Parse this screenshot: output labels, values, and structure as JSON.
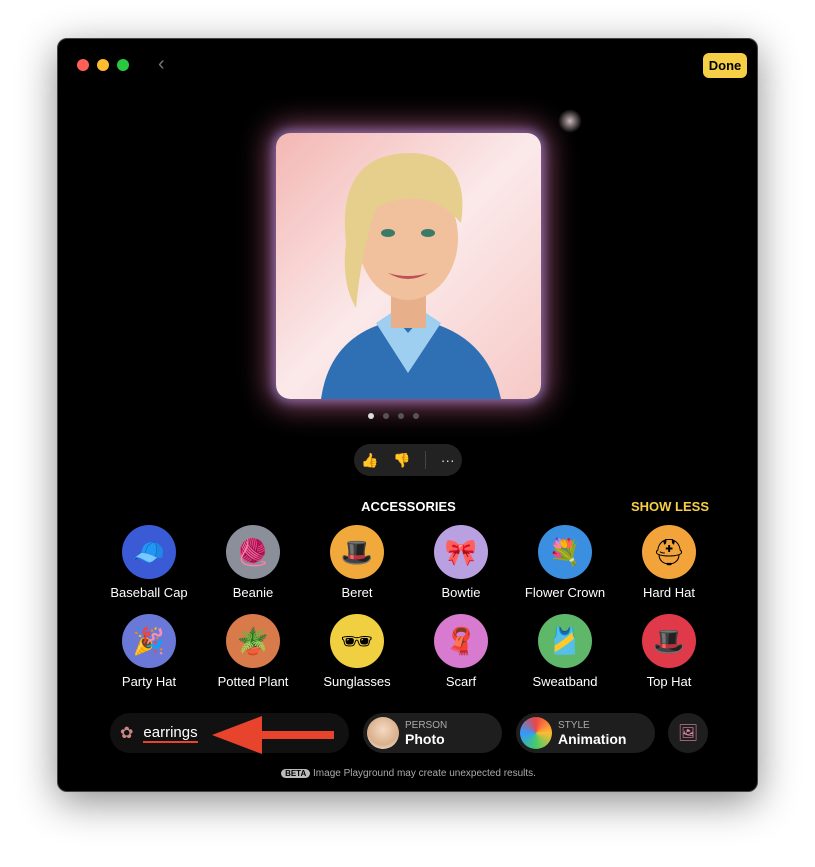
{
  "window": {
    "done_label": "Done",
    "traffic_lights": {
      "close": "#ff5f57",
      "minimize": "#febc2e",
      "zoom": "#28c840"
    }
  },
  "preview": {
    "page_count": 4,
    "current_page": 1
  },
  "feedback": {
    "thumbs_up": "thumbs-up-icon",
    "thumbs_down": "thumbs-down-icon",
    "more": "···"
  },
  "accessories": {
    "title": "ACCESSORIES",
    "toggle_label": "SHOW LESS",
    "items": [
      {
        "label": "Baseball Cap",
        "icon": "🧢",
        "bg": "#3b5bd6"
      },
      {
        "label": "Beanie",
        "icon": "🧶",
        "bg": "#8a8f99"
      },
      {
        "label": "Beret",
        "icon": "🎩",
        "bg": "#f0a93a"
      },
      {
        "label": "Bowtie",
        "icon": "🎀",
        "bg": "#b9a0e0"
      },
      {
        "label": "Flower Crown",
        "icon": "💐",
        "bg": "#3a8fe0"
      },
      {
        "label": "Hard Hat",
        "icon": "⛑",
        "bg": "#f2a43a"
      },
      {
        "label": "Party Hat",
        "icon": "🎉",
        "bg": "#6a78d8"
      },
      {
        "label": "Potted Plant",
        "icon": "🪴",
        "bg": "#d97a4a"
      },
      {
        "label": "Sunglasses",
        "icon": "🕶",
        "bg": "#f0d040"
      },
      {
        "label": "Scarf",
        "icon": "🧣",
        "bg": "#d77ad0"
      },
      {
        "label": "Sweatband",
        "icon": "🎽",
        "bg": "#5fb86a"
      },
      {
        "label": "Top Hat",
        "icon": "🎩",
        "bg": "#e03a4a"
      }
    ]
  },
  "bottom": {
    "prompt_value": "earrings",
    "person": {
      "caption": "PERSON",
      "value": "Photo"
    },
    "style": {
      "caption": "STYLE",
      "value": "Animation"
    }
  },
  "footer": {
    "badge": "BETA",
    "text": "Image Playground may create unexpected results."
  },
  "annotation_color": "#e8432d"
}
